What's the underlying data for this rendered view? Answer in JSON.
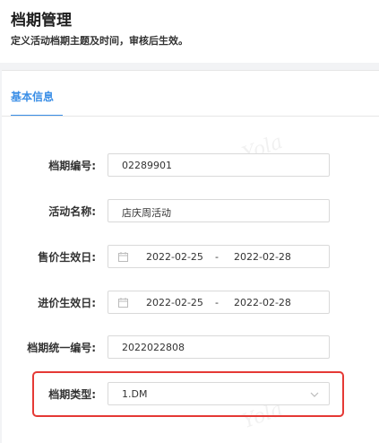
{
  "header": {
    "title": "档期管理",
    "subtitle": "定义活动档期主题及时间，审核后生效。"
  },
  "tabs": [
    {
      "label": "基本信息",
      "active": true
    }
  ],
  "form": {
    "schedule_no": {
      "label": "档期编号:",
      "value": "02289901"
    },
    "activity_name": {
      "label": "活动名称:",
      "value": "店庆周活动"
    },
    "sale_price_effective": {
      "label": "售价生效日:",
      "start": "2022-02-25",
      "separator": "-",
      "end": "2022-02-28"
    },
    "purchase_price_effective": {
      "label": "进价生效日:",
      "start": "2022-02-25",
      "separator": "-",
      "end": "2022-02-28"
    },
    "unified_no": {
      "label": "档期统一编号:",
      "value": "2022022808"
    },
    "schedule_type": {
      "label": "档期类型:",
      "value": "1.DM"
    }
  },
  "watermark": "Yola",
  "colors": {
    "accent": "#3a8ee6",
    "highlight": "#e53935"
  },
  "icons": {
    "date": "calendar-icon",
    "select": "chevron-down-icon"
  }
}
